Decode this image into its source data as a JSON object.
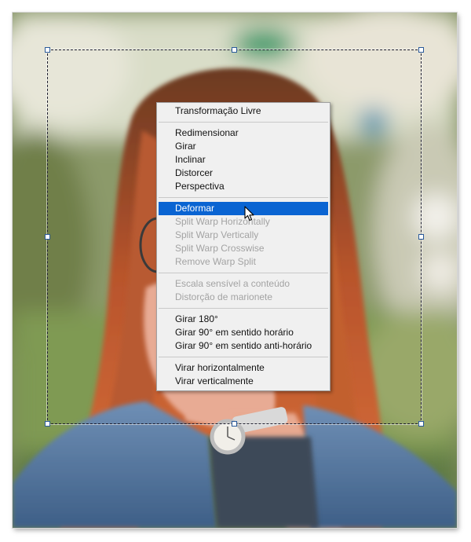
{
  "menu": {
    "groups": [
      [
        {
          "label": "Transformação Livre",
          "enabled": true
        }
      ],
      [
        {
          "label": "Redimensionar",
          "enabled": true
        },
        {
          "label": "Girar",
          "enabled": true
        },
        {
          "label": "Inclinar",
          "enabled": true
        },
        {
          "label": "Distorcer",
          "enabled": true
        },
        {
          "label": "Perspectiva",
          "enabled": true
        }
      ],
      [
        {
          "label": "Deformar",
          "enabled": true,
          "selected": true
        },
        {
          "label": "Split Warp Horizontally",
          "enabled": false
        },
        {
          "label": "Split Warp Vertically",
          "enabled": false
        },
        {
          "label": "Split Warp Crosswise",
          "enabled": false
        },
        {
          "label": "Remove Warp Split",
          "enabled": false
        }
      ],
      [
        {
          "label": "Escala sensível a conteúdo",
          "enabled": false
        },
        {
          "label": "Distorção de marionete",
          "enabled": false
        }
      ],
      [
        {
          "label": "Girar 180°",
          "enabled": true
        },
        {
          "label": "Girar 90° em sentido horário",
          "enabled": true
        },
        {
          "label": "Girar 90° em sentido anti-horário",
          "enabled": true
        }
      ],
      [
        {
          "label": "Virar horizontalmente",
          "enabled": true
        },
        {
          "label": "Virar verticalmente",
          "enabled": true
        }
      ]
    ]
  },
  "colors": {
    "menu_background": "#f0f0f0",
    "selection": "#0a64d2",
    "disabled_text": "#a3a3a3",
    "handle_border": "#2a5a9a"
  },
  "icons": {
    "cursor": "arrow-pointer-icon",
    "transform_handle": "square-handle-icon"
  }
}
